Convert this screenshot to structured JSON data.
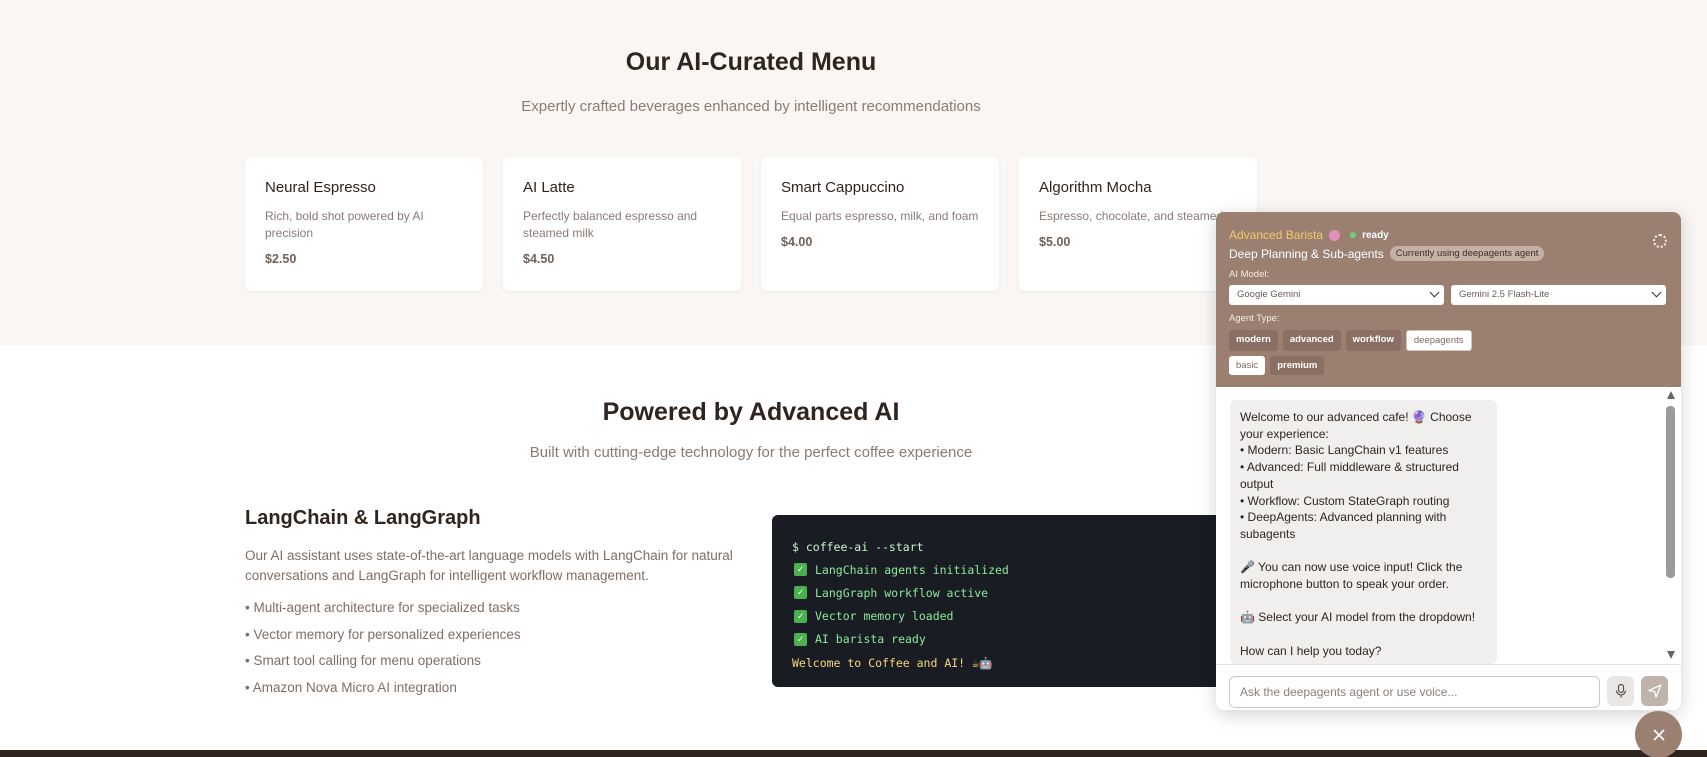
{
  "menu": {
    "title": "Our AI-Curated Menu",
    "subtitle": "Expertly crafted beverages enhanced by intelligent recommendations",
    "items": [
      {
        "name": "Neural Espresso",
        "description": "Rich, bold shot powered by AI precision",
        "price": "$2.50"
      },
      {
        "name": "AI Latte",
        "description": "Perfectly balanced espresso and steamed milk",
        "price": "$4.50"
      },
      {
        "name": "Smart Cappuccino",
        "description": "Equal parts espresso, milk, and foam",
        "price": "$4.00"
      },
      {
        "name": "Algorithm Mocha",
        "description": "Espresso, chocolate, and steamed",
        "price": "$5.00"
      }
    ]
  },
  "powered": {
    "title": "Powered by Advanced AI",
    "subtitle": "Built with cutting-edge technology for the perfect coffee experience",
    "langchain": {
      "title": "LangChain & LangGraph",
      "description": "Our AI assistant uses state-of-the-art language models with LangChain for natural conversations and LangGraph for intelligent workflow management.",
      "features": [
        "• Multi-agent architecture for specialized tasks",
        "• Vector memory for personalized experiences",
        "• Smart tool calling for menu operations",
        "• Amazon Nova Micro AI integration"
      ]
    },
    "terminal": {
      "command": "$ coffee-ai --start",
      "lines": [
        "LangChain agents initialized",
        "LangGraph workflow active",
        "Vector memory loaded",
        "AI barista ready"
      ],
      "check_glyph": "✓",
      "welcome": "Welcome to Coffee and AI! ☕🤖"
    }
  },
  "chat": {
    "agent_name": "Advanced Barista",
    "status": "ready",
    "subtitle": "Deep Planning & Sub-agents",
    "using_badge": "Currently using deepagents agent",
    "model_label": "AI Model:",
    "provider": "Google Gemini",
    "model": "Gemini 2.5 Flash-Lite",
    "agent_type_label": "Agent Type:",
    "agent_types": [
      "modern",
      "advanced",
      "workflow",
      "deepagents",
      "basic",
      "premium"
    ],
    "selected_agent_type": "deepagents",
    "message": "Welcome to our advanced cafe! 🔮 Choose your experience:\n• Modern: Basic LangChain v1 features\n• Advanced: Full middleware & structured output\n• Workflow: Custom StateGraph routing\n• DeepAgents: Advanced planning with subagents\n\n🎤 You can now use voice input! Click the microphone button to speak your order.\n\n🤖 Select your AI model from the dropdown!\n\nHow can I help you today?",
    "input_placeholder": "Ask the deepagents agent or use voice...",
    "icons": {
      "settings": "gear-icon",
      "mic": "microphone-icon",
      "send": "send-icon",
      "close": "close-icon"
    },
    "colors": {
      "header_bg": "#9b8072",
      "agent_name": "#f3c96a",
      "status_dot": "#6ed27a"
    }
  }
}
